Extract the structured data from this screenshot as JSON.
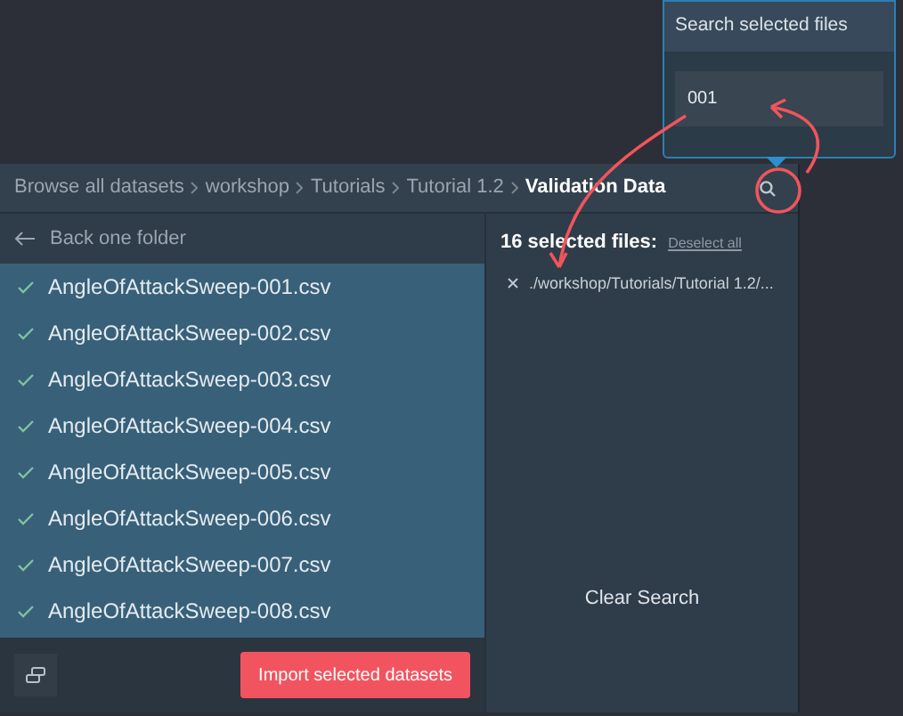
{
  "breadcrumbs": [
    {
      "label": "Browse all datasets",
      "selected": false
    },
    {
      "label": "workshop",
      "selected": false
    },
    {
      "label": "Tutorials",
      "selected": false
    },
    {
      "label": "Tutorial 1.2",
      "selected": false
    },
    {
      "label": "Validation Data",
      "selected": true
    }
  ],
  "back_label": "Back one folder",
  "files": [
    {
      "name": "AngleOfAttackSweep-001.csv",
      "checked": true
    },
    {
      "name": "AngleOfAttackSweep-002.csv",
      "checked": true
    },
    {
      "name": "AngleOfAttackSweep-003.csv",
      "checked": true
    },
    {
      "name": "AngleOfAttackSweep-004.csv",
      "checked": true
    },
    {
      "name": "AngleOfAttackSweep-005.csv",
      "checked": true
    },
    {
      "name": "AngleOfAttackSweep-006.csv",
      "checked": true
    },
    {
      "name": "AngleOfAttackSweep-007.csv",
      "checked": true
    },
    {
      "name": "AngleOfAttackSweep-008.csv",
      "checked": true
    }
  ],
  "import_button": "Import selected datasets",
  "selection": {
    "count_label": "16 selected files:",
    "deselect_link": "Deselect all",
    "items": [
      {
        "path": "./workshop/Tutorials/Tutorial 1.2/..."
      }
    ],
    "clear_search": "Clear Search"
  },
  "search_popover": {
    "title": "Search selected files",
    "value": "001"
  }
}
